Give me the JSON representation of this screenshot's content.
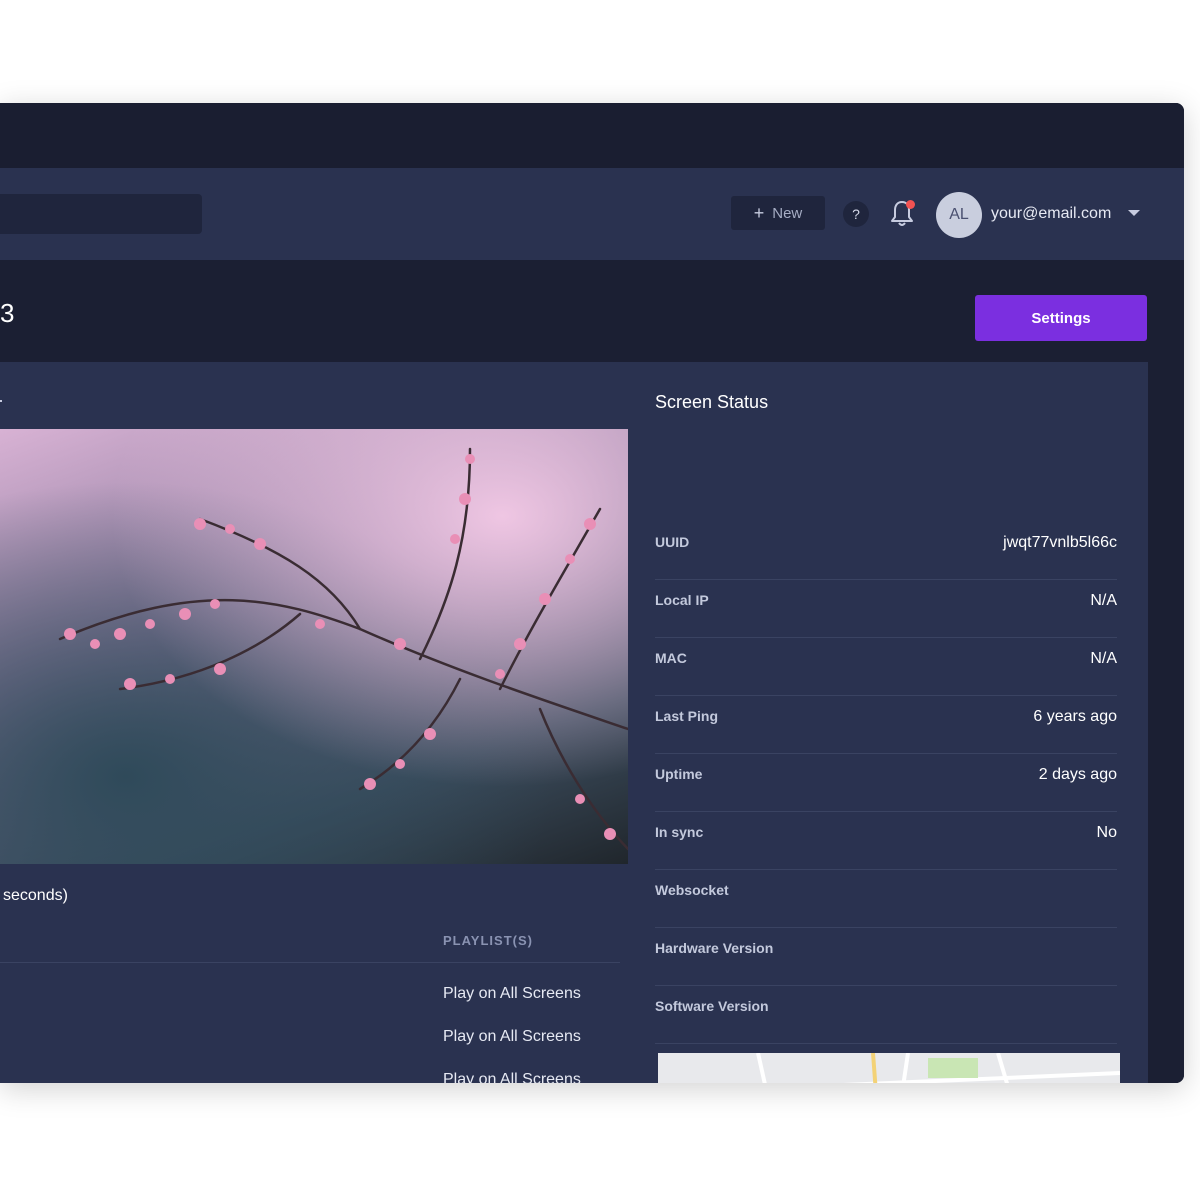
{
  "navbar": {
    "new_label": "New",
    "help_label": "?",
    "avatar_initials": "AL",
    "email": "your@email.com"
  },
  "header": {
    "title_fragment": "3",
    "settings_label": "Settings"
  },
  "preview": {
    "duration_text": "seconds)"
  },
  "playlists": {
    "header": "PLAYLIST(S)",
    "items": [
      "Play on All Screens",
      "Play on All Screens",
      "Play on All Screens"
    ]
  },
  "status": {
    "title": "Screen Status",
    "rows": [
      {
        "label": "UUID",
        "value": "jwqt77vnlb5l66c"
      },
      {
        "label": "Local IP",
        "value": "N/A"
      },
      {
        "label": "MAC",
        "value": "N/A"
      },
      {
        "label": "Last Ping",
        "value": "6 years ago"
      },
      {
        "label": "Uptime",
        "value": "2 days ago"
      },
      {
        "label": "In sync",
        "value": "No"
      },
      {
        "label": "Websocket",
        "value": ""
      },
      {
        "label": "Hardware Version",
        "value": ""
      },
      {
        "label": "Software Version",
        "value": ""
      }
    ]
  },
  "colors": {
    "accent": "#7b2fe0",
    "background": "#1b1f33",
    "panel": "#2a3250",
    "notification_dot": "#f25252"
  }
}
